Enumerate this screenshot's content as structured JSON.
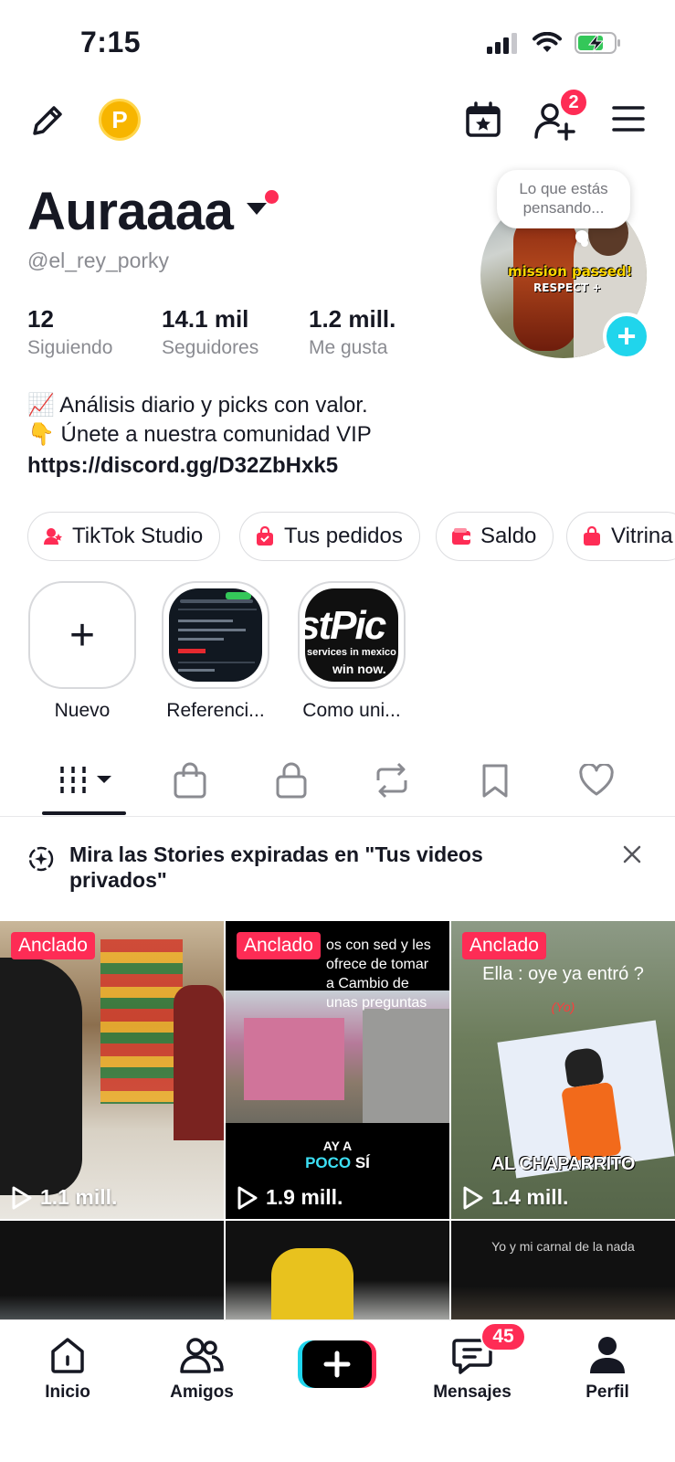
{
  "status_bar": {
    "time": "7:15"
  },
  "header": {
    "coin_letter": "P",
    "follow_badge": "2"
  },
  "profile": {
    "display_name": "Auraaaa",
    "handle": "@el_rey_porky",
    "thought_bubble": "Lo que estás pensando...",
    "avatar_text_1": "mission passed!",
    "avatar_text_2": "RESPECT +"
  },
  "stats": [
    {
      "value": "12",
      "label": "Siguiendo"
    },
    {
      "value": "14.1 mil",
      "label": "Seguidores"
    },
    {
      "value": "1.2 mill.",
      "label": "Me gusta"
    }
  ],
  "bio": {
    "line1": "📈 Análisis diario y picks con valor.",
    "line2": "👇 Únete a nuestra comunidad VIP",
    "link": "https://discord.gg/D32ZbHxk5"
  },
  "chips": [
    {
      "label": "TikTok Studio",
      "icon": "studio-icon"
    },
    {
      "label": "Tus pedidos",
      "icon": "shopping-bag-icon"
    },
    {
      "label": "Saldo",
      "icon": "wallet-icon"
    },
    {
      "label": "Vitrina",
      "icon": "shopping-bag-icon"
    }
  ],
  "highlights": [
    {
      "label": "Nuevo",
      "symbol": "+"
    },
    {
      "label": "Referenci..."
    },
    {
      "label": "Como uni...",
      "thumb_text": "stPic",
      "thumb_sub": "services in mexico",
      "thumb_sub2": "win now."
    }
  ],
  "tabs": [
    {
      "name": "videos-tab",
      "icon": "grid-icon",
      "active": true
    },
    {
      "name": "shop-tab",
      "icon": "shopping-bag-icon"
    },
    {
      "name": "private-tab",
      "icon": "lock-icon"
    },
    {
      "name": "reposts-tab",
      "icon": "repost-icon"
    },
    {
      "name": "favorites-tab",
      "icon": "bookmark-icon"
    },
    {
      "name": "liked-tab",
      "icon": "heart-icon"
    }
  ],
  "banner": {
    "text": "Mira las Stories expiradas en \"Tus videos privados\""
  },
  "videos": [
    {
      "pinned": "Anclado",
      "views": "1.1 mill."
    },
    {
      "pinned": "Anclado",
      "views": "1.9 mill.",
      "caption_top": "os con sed y les ofrece de tomar a Cambio de unas preguntas",
      "caption_bottom_1": "AY A",
      "caption_bottom_2a": "POCO",
      "caption_bottom_2b": " SÍ"
    },
    {
      "pinned": "Anclado",
      "views": "1.4 mill.",
      "caption_top": "Ella : oye ya entró ?",
      "caption_sub": "(Yo)",
      "caption_bottom": "AL CHAPARRITO"
    },
    {},
    {},
    {
      "caption_top": "Yo y mi carnal de la nada"
    }
  ],
  "bottom_nav": [
    {
      "label": "Inicio",
      "icon": "home-icon"
    },
    {
      "label": "Amigos",
      "icon": "friends-icon"
    },
    {
      "label": "",
      "icon": "create-icon"
    },
    {
      "label": "Mensajes",
      "icon": "messages-icon",
      "badge": "45"
    },
    {
      "label": "Perfil",
      "icon": "profile-icon"
    }
  ],
  "colors": {
    "accent": "#fe2c55",
    "cyan": "#20d5ec",
    "text": "#161823",
    "muted": "#8a8b91"
  }
}
